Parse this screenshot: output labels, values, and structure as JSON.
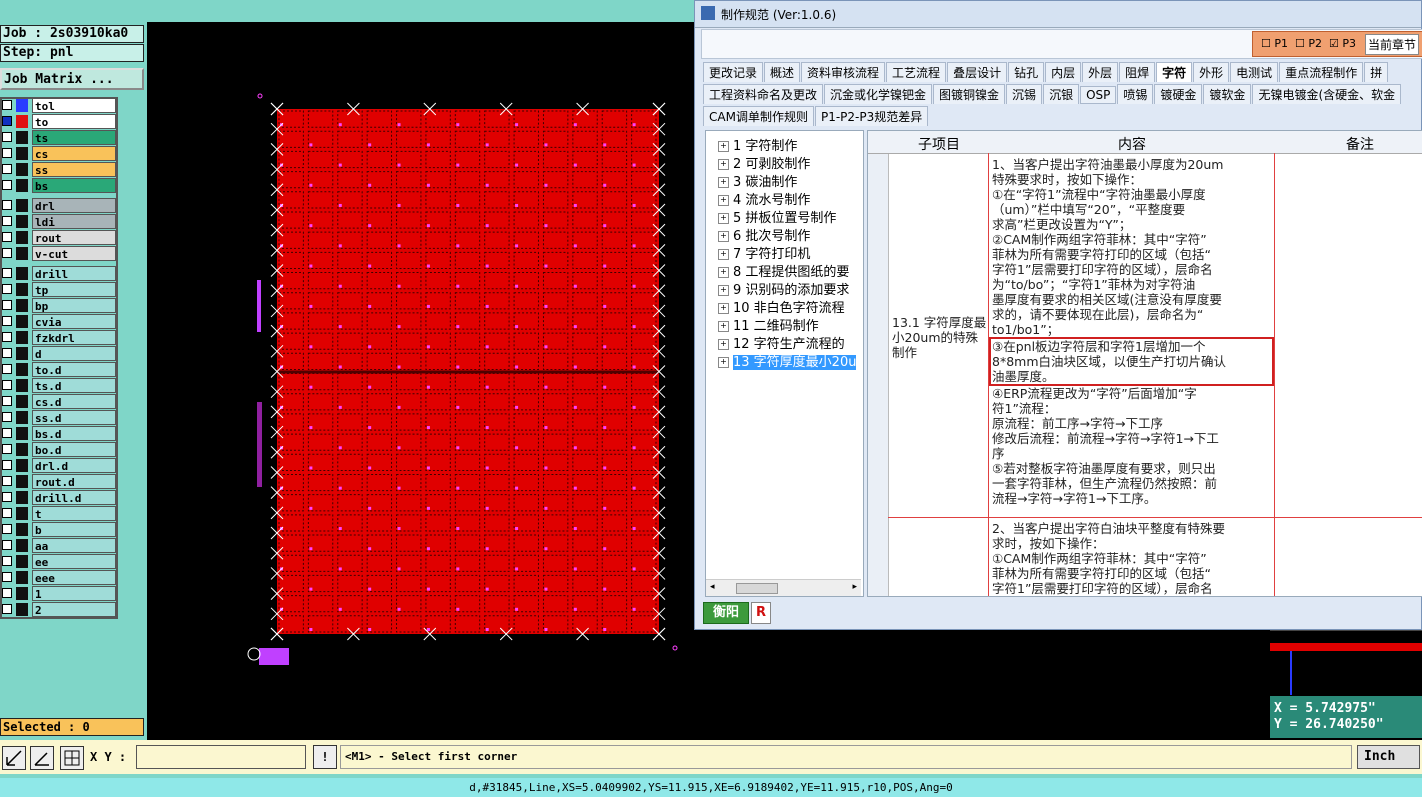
{
  "left_panel": {
    "job_label": "Job : 2s03910ka0",
    "step_label": "Step: pnl",
    "job_matrix_button": "Job Matrix ...",
    "selected_label": "Selected : 0",
    "layers": [
      {
        "name": "tol",
        "color": "#2a3bff",
        "bg": "#ffffff",
        "checked": false
      },
      {
        "name": "to",
        "color": "#e01010",
        "bg": "#ffffff",
        "checked": true
      },
      {
        "name": "ts",
        "color": "#111111",
        "bg": "#2aa878",
        "checked": false
      },
      {
        "name": "cs",
        "color": "#111111",
        "bg": "#f9c25a",
        "checked": false
      },
      {
        "name": "ss",
        "color": "#111111",
        "bg": "#f9c25a",
        "checked": false
      },
      {
        "name": "bs",
        "color": "#111111",
        "bg": "#2aa878",
        "checked": false
      },
      {
        "name": "drl",
        "color": "#111111",
        "bg": "#a8b4b8",
        "checked": false
      },
      {
        "name": "ldi",
        "color": "#111111",
        "bg": "#a8b4b8",
        "checked": false
      },
      {
        "name": "rout",
        "color": "#111111",
        "bg": "#dcdcdc",
        "checked": false
      },
      {
        "name": "v-cut",
        "color": "#111111",
        "bg": "#dcdcdc",
        "checked": false
      },
      {
        "name": "drill",
        "color": "#111111",
        "bg": "#9fdcd8",
        "checked": false
      },
      {
        "name": "tp",
        "color": "#111111",
        "bg": "#9fdcd8",
        "checked": false
      },
      {
        "name": "bp",
        "color": "#111111",
        "bg": "#9fdcd8",
        "checked": false
      },
      {
        "name": "cvia",
        "color": "#111111",
        "bg": "#9fdcd8",
        "checked": false
      },
      {
        "name": "fzkdrl",
        "color": "#111111",
        "bg": "#9fdcd8",
        "checked": false
      },
      {
        "name": "d",
        "color": "#111111",
        "bg": "#9fdcd8",
        "checked": false
      },
      {
        "name": "to.d",
        "color": "#111111",
        "bg": "#9fdcd8",
        "checked": false
      },
      {
        "name": "ts.d",
        "color": "#111111",
        "bg": "#9fdcd8",
        "checked": false
      },
      {
        "name": "cs.d",
        "color": "#111111",
        "bg": "#9fdcd8",
        "checked": false
      },
      {
        "name": "ss.d",
        "color": "#111111",
        "bg": "#9fdcd8",
        "checked": false
      },
      {
        "name": "bs.d",
        "color": "#111111",
        "bg": "#9fdcd8",
        "checked": false
      },
      {
        "name": "bo.d",
        "color": "#111111",
        "bg": "#9fdcd8",
        "checked": false
      },
      {
        "name": "drl.d",
        "color": "#111111",
        "bg": "#9fdcd8",
        "checked": false
      },
      {
        "name": "rout.d",
        "color": "#111111",
        "bg": "#9fdcd8",
        "checked": false
      },
      {
        "name": "drill.d",
        "color": "#111111",
        "bg": "#9fdcd8",
        "checked": false
      },
      {
        "name": "t",
        "color": "#111111",
        "bg": "#9fdcd8",
        "checked": false
      },
      {
        "name": "b",
        "color": "#111111",
        "bg": "#9fdcd8",
        "checked": false
      },
      {
        "name": "aa",
        "color": "#111111",
        "bg": "#9fdcd8",
        "checked": false
      },
      {
        "name": "ee",
        "color": "#111111",
        "bg": "#9fdcd8",
        "checked": false
      },
      {
        "name": "eee",
        "color": "#111111",
        "bg": "#9fdcd8",
        "checked": false
      },
      {
        "name": "1",
        "color": "#111111",
        "bg": "#9fdcd8",
        "checked": false
      },
      {
        "name": "2",
        "color": "#111111",
        "bg": "#9fdcd8",
        "checked": false
      }
    ]
  },
  "coords": {
    "x": "X = 5.742975\"",
    "y": "Y = 26.740250\""
  },
  "command_bar": {
    "xy_label": "X Y :",
    "xy_value": "",
    "prompt": "<M1> - Select first corner",
    "unit": "Inch"
  },
  "status_line": "d,#31845,Line,XS=5.0409902,YS=11.915,XE=6.9189402,YE=11.915,r10,POS,Ang=0",
  "dialog": {
    "title": "制作规范 (Ver:1.0.6)",
    "options": {
      "p1": "P1",
      "p2": "P2",
      "p3": "P3",
      "current_chapter": "当前章节"
    },
    "tabs_row1": [
      "更改记录",
      "概述",
      "资料审核流程",
      "工艺流程",
      "叠层设计",
      "钻孔",
      "内层",
      "外层",
      "阻焊",
      "字符",
      "外形",
      "电测试",
      "重点流程制作",
      "拼"
    ],
    "active_tab": "字符",
    "tabs_row2": [
      "工程资料命名及更改",
      "沉金或化学镍钯金",
      "图镀铜镍金",
      "沉锡",
      "沉银",
      "OSP",
      "喷锡",
      "镀硬金",
      "镀软金",
      "无镍电镀金(含硬金、软金"
    ],
    "tabs_row3": [
      "CAM调单制作规则",
      "P1-P2-P3规范差异"
    ],
    "tree": [
      "1  字符制作",
      "2  可剥胶制作",
      "3  碳油制作",
      "4  流水号制作",
      "5  拼板位置号制作",
      "6  批次号制作",
      "7  字符打印机",
      "8  工程提供图纸的要",
      "9  识别码的添加要求",
      "10  非白色字符流程",
      "11  二维码制作",
      "12  字符生产流程的",
      "13  字符厚度最小20u"
    ],
    "table_headers": {
      "sub": "子项目",
      "content": "内容",
      "remark": "备注"
    },
    "row1_sub": "13.1 字符厚度最小20um的特殊制作",
    "row1_lines": [
      "1、当客户提出字符油墨最小厚度为20um",
      "特殊要求时，按如下操作：",
      "①在“字符1”流程中“字符油墨最小厚度",
      "（um）”栏中填写“20”，“平整度要",
      "求高”栏更改设置为“Y”；",
      "②CAM制作两组字符菲林：其中“字符”",
      "菲林为所有需要字符打印的区域（包括“",
      "字符1”层需要打印字符的区域），层命名",
      "为“to/bo”；“字符1”菲林为对字符油",
      "墨厚度有要求的相关区域(注意没有厚度要",
      "求的，请不要体现在此层)，层命名为“",
      "to1/bo1”；"
    ],
    "row1_highlight": [
      "③在pnl板边字符层和字符1层增加一个",
      "8*8mm白油块区域，以便生产打切片确认",
      "油墨厚度。"
    ],
    "row1_lines_after": [
      "④ERP流程更改为“字符”后面增加“字",
      "符1”流程：",
      "原流程：前工序→字符→下工序",
      "修改后流程：前流程→字符→字符1→下工",
      "序",
      "⑤若对整板字符油墨厚度有要求，则只出",
      "一套字符菲林，但生产流程仍然按照：前",
      "流程→字符→字符1→下工序。"
    ],
    "row2_lines": [
      "2、当客户提出字符白油块平整度有特殊要",
      "求时，按如下操作：",
      "①CAM制作两组字符菲林：其中“字符”",
      "菲林为所有需要字符打印的区域（包括“",
      "字符1”层需要打印字符的区域），层命名"
    ],
    "bottom_tab": "衡阳",
    "bottom_tab2": "R"
  }
}
